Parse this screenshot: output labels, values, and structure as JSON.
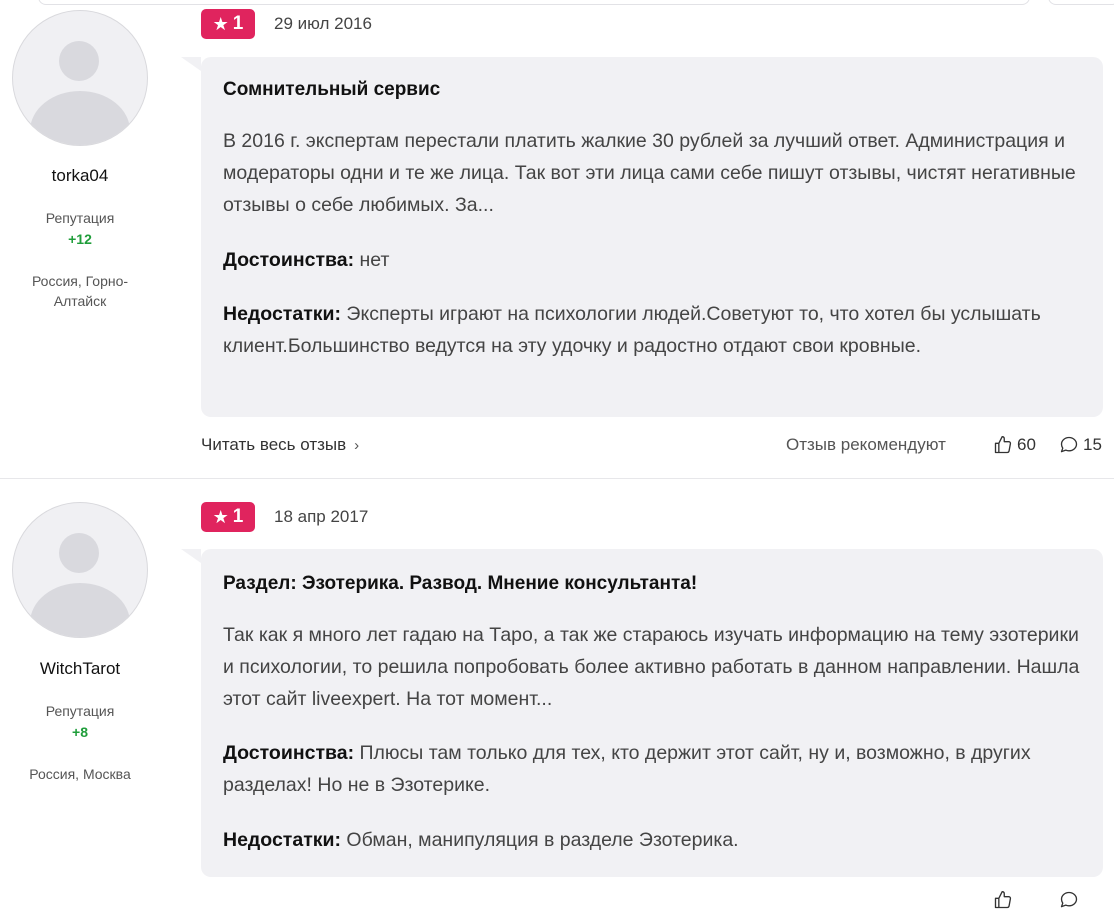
{
  "reviews": [
    {
      "author": {
        "username": "torka04",
        "reputation_label": "Репутация",
        "reputation_value": "+12",
        "location": "Россия, Горно-Алтайск"
      },
      "rating": "1",
      "date": "29 июл 2016",
      "title": "Сомнительный сервис",
      "body": "В 2016 г. экспертам перестали платить жалкие 30 рублей за лучший ответ. Администрация и модераторы одни и те же лица. Так вот эти лица сами себе пишут отзывы, чистят негативные отзывы о себе любимых. За...",
      "pros_label": "Достоинства:",
      "pros": "нет",
      "cons_label": "Недостатки:",
      "cons": "Эксперты играют на психологии людей.Советуют то, что хотел бы услышать клиент.Большинство ведутся на эту удочку и радостно отдают свои кровные.",
      "read_more": "Читать весь отзыв",
      "recommend_label": "Отзыв рекомендуют",
      "likes": "60",
      "comments": "15"
    },
    {
      "author": {
        "username": "WitchTarot",
        "reputation_label": "Репутация",
        "reputation_value": "+8",
        "location": "Россия, Москва"
      },
      "rating": "1",
      "date": "18 апр 2017",
      "title": "Раздел: Эзотерика. Развод. Мнение консультанта!",
      "body": "Так как я много лет гадаю на Таро, а так же стараюсь изучать информацию на тему эзотерики и психологии, то решила попробовать более активно работать в данном направлении. Нашла этот сайт liveexpert. На тот момент...",
      "pros_label": "Достоинства:",
      "pros": "Плюсы там только для тех, кто держит этот сайт, ну и, возможно, в других разделах! Но не в Эзотерике.",
      "cons_label": "Недостатки:",
      "cons": "Обман, манипуляция в разделе Эзотерика."
    }
  ],
  "colors": {
    "badge": "#e0245e",
    "bubble": "#f1f1f4",
    "reputation": "#1f9d3a"
  },
  "icons": {
    "rating": "star-icon",
    "read_more": "chevron-right-icon",
    "likes": "thumbs-up-icon",
    "comments": "comment-icon"
  }
}
